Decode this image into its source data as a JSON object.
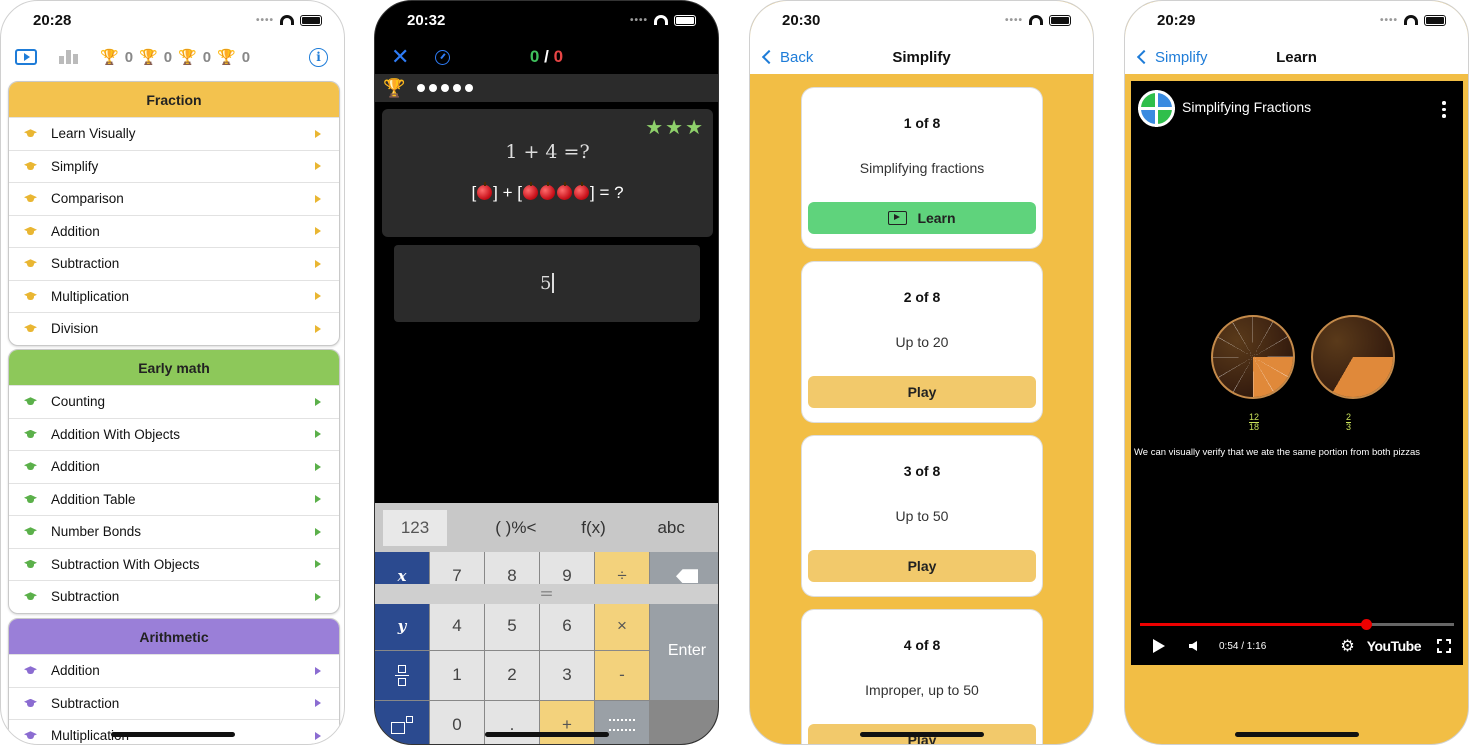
{
  "phone1": {
    "time": "20:28",
    "trophy_counts": [
      "0",
      "0",
      "0",
      "0"
    ],
    "sections": [
      {
        "title": "Fraction",
        "color": "#f3c24e",
        "accent": "#e9b632",
        "items": [
          "Learn Visually",
          "Simplify",
          "Comparison",
          "Addition",
          "Subtraction",
          "Multiplication",
          "Division"
        ]
      },
      {
        "title": "Early math",
        "color": "#8dc85a",
        "accent": "#5bb04a",
        "items": [
          "Counting",
          "Addition With Objects",
          "Addition",
          "Addition Table",
          "Number Bonds",
          "Subtraction With Objects",
          "Subtraction"
        ]
      },
      {
        "title": "Arithmetic",
        "color": "#9a7fd8",
        "accent": "#8b6cd1",
        "items": [
          "Addition",
          "Subtraction",
          "Multiplication"
        ]
      }
    ]
  },
  "phone2": {
    "time": "20:32",
    "score_correct": "0",
    "score_sep": "/",
    "score_wrong": "0",
    "equation": "1 + 4 =?",
    "apple_eq_open": "[",
    "apple_eq_mid": "] + [",
    "apple_eq_end": "] = ?",
    "answer": "5",
    "kb_tabs": [
      "123",
      "( )%<",
      "f(x)",
      "abc"
    ],
    "keys": {
      "x": "x",
      "y": "y",
      "n7": "7",
      "n8": "8",
      "n9": "9",
      "div": "÷",
      "n4": "4",
      "n5": "5",
      "n6": "6",
      "mul": "×",
      "n1": "1",
      "n2": "2",
      "n3": "3",
      "minus": "-",
      "n0": "0",
      "dot": ".",
      "equals": "=",
      "plus": "+",
      "enter": "Enter"
    }
  },
  "phone3": {
    "time": "20:30",
    "back_label": "Back",
    "title": "Simplify",
    "cards": [
      {
        "num": "1 of 8",
        "desc": "Simplifying fractions",
        "button": "Learn"
      },
      {
        "num": "2 of 8",
        "desc": "Up to 20",
        "button": "Play"
      },
      {
        "num": "3 of 8",
        "desc": "Up to 50",
        "button": "Play"
      },
      {
        "num": "4 of 8",
        "desc": "Improper, up to 50",
        "button": "Play"
      }
    ]
  },
  "phone4": {
    "time": "20:29",
    "back_label": "Simplify",
    "title": "Learn",
    "video_title": "Simplifying Fractions",
    "frac1_num": "12",
    "frac1_den": "18",
    "frac2_num": "2",
    "frac2_den": "3",
    "caption": "We can visually verify that we ate the same portion from both pizzas",
    "time_display": "0:54 / 1:16",
    "progress": 0.72,
    "yt_label": "YouTube"
  }
}
